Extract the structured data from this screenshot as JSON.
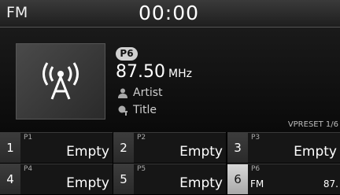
{
  "header": {
    "mode": "FM",
    "clock": "00:00"
  },
  "now_playing": {
    "preset_badge": "P6",
    "frequency": "87.50",
    "unit": "MHz",
    "artist": "Artist",
    "title": "Title",
    "preset_indicator": "VPRESET 1/6"
  },
  "presets": [
    {
      "num": "1",
      "label": "P1",
      "text": "Empty"
    },
    {
      "num": "2",
      "label": "P2",
      "text": "Empty"
    },
    {
      "num": "3",
      "label": "P3",
      "text": "Empty"
    },
    {
      "num": "4",
      "label": "P4",
      "text": "Empty"
    },
    {
      "num": "5",
      "label": "P5",
      "text": "Empty"
    },
    {
      "num": "6",
      "label": "P6",
      "band": "FM",
      "freq": "87."
    }
  ]
}
